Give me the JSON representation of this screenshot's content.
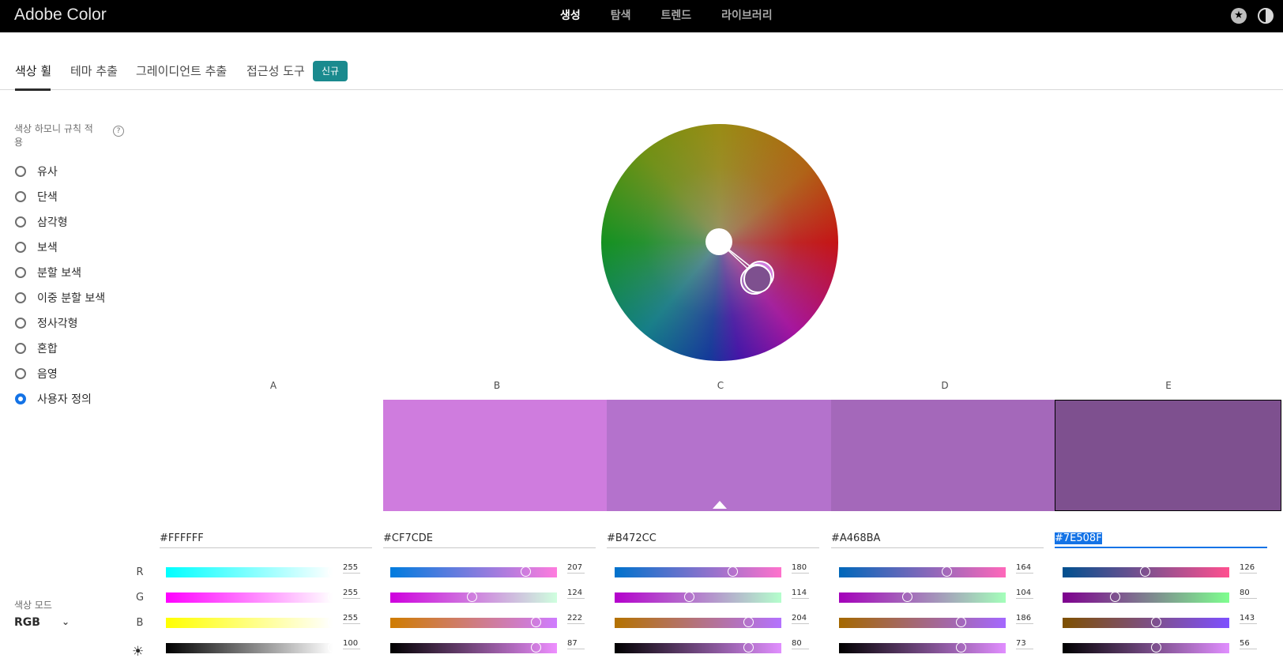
{
  "app": {
    "title": "Adobe Color"
  },
  "topnav": [
    "생성",
    "탐색",
    "트렌드",
    "라이브러리"
  ],
  "subnav": {
    "tabs": [
      "색상 휠",
      "테마 추출",
      "그레이디언트 추출",
      "접근성 도구"
    ],
    "badge": "신규"
  },
  "harmony": {
    "label": "색상 하모니 규칙 적용",
    "rules": [
      "유사",
      "단색",
      "삼각형",
      "보색",
      "분할 보색",
      "이중 분할 보색",
      "정사각형",
      "혼합",
      "음영",
      "사용자 정의"
    ],
    "selected": "사용자 정의"
  },
  "color_mode": {
    "label": "색상 모드",
    "value": "RGB"
  },
  "channels": [
    "R",
    "G",
    "B"
  ],
  "swatches": [
    {
      "letter": "A",
      "hex": "#FFFFFF",
      "r": "255",
      "g": "255",
      "b": "255",
      "brightness": "100"
    },
    {
      "letter": "B",
      "hex": "#CF7CDE",
      "r": "207",
      "g": "124",
      "b": "222",
      "brightness": "87"
    },
    {
      "letter": "C",
      "hex": "#B472CC",
      "r": "180",
      "g": "114",
      "b": "204",
      "brightness": "80"
    },
    {
      "letter": "D",
      "hex": "#A468BA",
      "r": "164",
      "g": "104",
      "b": "186",
      "brightness": "73"
    },
    {
      "letter": "E",
      "hex": "#7E508F",
      "r": "126",
      "g": "80",
      "b": "143",
      "brightness": "56"
    }
  ],
  "base_swatch": "C",
  "selected_swatch": "E"
}
